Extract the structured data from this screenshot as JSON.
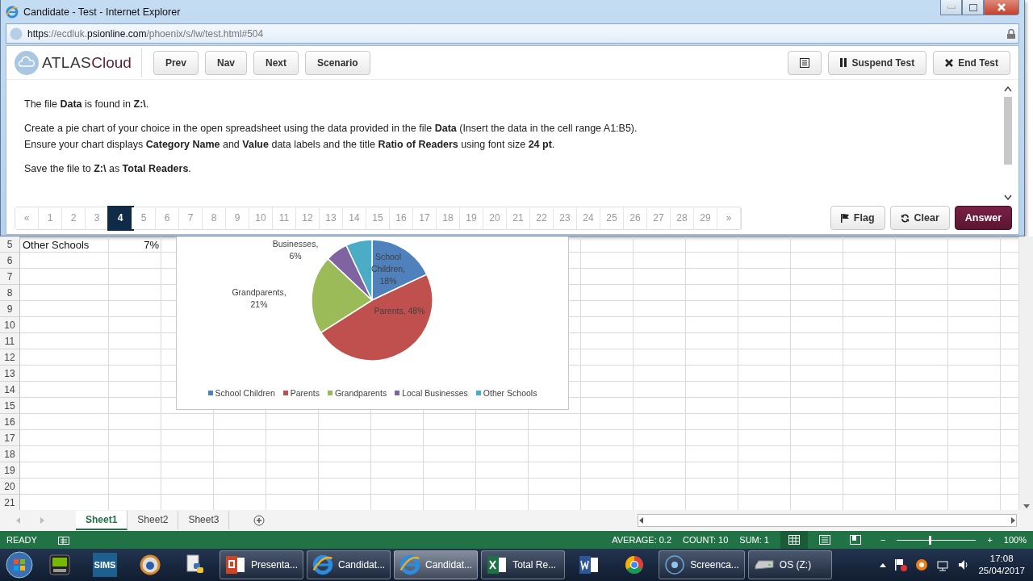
{
  "browser": {
    "title": "Candidate - Test - Internet Explorer",
    "address_parts": [
      {
        "text": "https",
        "strong": true
      },
      {
        "text": "://ecdluk.",
        "strong": false
      },
      {
        "text": "psionline.com",
        "strong": true
      },
      {
        "text": "/phoenix/s/lw/test.html#504",
        "strong": false
      }
    ]
  },
  "logo": {
    "part_1": "ATLAS",
    "part_2": "Cloud"
  },
  "toolbar_left": [
    "Prev",
    "Nav",
    "Next",
    "Scenario"
  ],
  "toolbar_right": [
    {
      "label": "Suspend Test",
      "kind": "pause"
    },
    {
      "label": "End Test",
      "kind": "end"
    }
  ],
  "question": [
    "The file **Data** is found in **Z:\\**.",
    "Create a pie chart of your choice in the open spreadsheet using the data provided in the file **Data** (Insert the data in the cell range A1:B5). Ensure your chart displays **Category Name** and **Value** data labels and the title **Ratio of Readers** using font size **24 pt**.",
    "Save the file to **Z:\\** as **Total Readers**."
  ],
  "pagination": {
    "prev": "«",
    "next": "»",
    "pages": [
      {
        "label": "1",
        "selected": false
      },
      {
        "label": "2",
        "selected": false
      },
      {
        "label": "3",
        "selected": false
      },
      {
        "label": "4",
        "selected": true
      },
      {
        "label": "5",
        "selected": false
      },
      {
        "label": "6",
        "selected": false
      },
      {
        "label": "7",
        "selected": false
      },
      {
        "label": "8",
        "selected": false
      },
      {
        "label": "9",
        "selected": false
      },
      {
        "label": "10",
        "selected": false
      },
      {
        "label": "11",
        "selected": false
      },
      {
        "label": "12",
        "selected": false
      },
      {
        "label": "13",
        "selected": false
      },
      {
        "label": "14",
        "selected": false
      },
      {
        "label": "15",
        "selected": false
      },
      {
        "label": "16",
        "selected": false
      },
      {
        "label": "17",
        "selected": false
      },
      {
        "label": "18",
        "selected": false
      },
      {
        "label": "19",
        "selected": false
      },
      {
        "label": "20",
        "selected": false
      },
      {
        "label": "21",
        "selected": false
      },
      {
        "label": "22",
        "selected": false
      },
      {
        "label": "23",
        "selected": false
      },
      {
        "label": "24",
        "selected": false
      },
      {
        "label": "25",
        "selected": false
      },
      {
        "label": "26",
        "selected": false
      },
      {
        "label": "27",
        "selected": false
      },
      {
        "label": "28",
        "selected": false
      },
      {
        "label": "29",
        "selected": false
      }
    ]
  },
  "actions": [
    {
      "label": "Flag",
      "kind": "flag"
    },
    {
      "label": "Clear",
      "kind": "clear"
    },
    {
      "label": "Answer",
      "kind": "primary"
    }
  ],
  "sheet": {
    "rows": [
      {
        "number": "5",
        "cells": [
          "Other Schools",
          "7%"
        ]
      },
      {
        "number": "6"
      },
      {
        "number": "7"
      },
      {
        "number": "8"
      },
      {
        "number": "9"
      },
      {
        "number": "10"
      },
      {
        "number": "11"
      },
      {
        "number": "12"
      },
      {
        "number": "13"
      },
      {
        "number": "14"
      },
      {
        "number": "15"
      },
      {
        "number": "16"
      },
      {
        "number": "17"
      },
      {
        "number": "18"
      },
      {
        "number": "19"
      },
      {
        "number": "20"
      },
      {
        "number": "21"
      }
    ],
    "chart_data": {
      "type": "pie",
      "categories": [
        "School Children",
        "Parents",
        "Grandparents",
        "Local Businesses",
        "Other Schools"
      ],
      "values": [
        18,
        48,
        21,
        6,
        7
      ],
      "colors": [
        "#4f81bd",
        "#c0504d",
        "#9bbb59",
        "#8064a2",
        "#4bacc6"
      ],
      "legend": "bottom",
      "value_labels": [
        "School Children, 18%",
        "Parents, 48%",
        "Grandparents, 21%",
        "Businesses, 6%",
        null
      ]
    }
  },
  "sheet_tabs": [
    {
      "label": "Sheet1",
      "selected": true
    },
    {
      "label": "Sheet2",
      "selected": false
    },
    {
      "label": "Sheet3",
      "selected": false
    }
  ],
  "status_bar": {
    "mode": "READY",
    "stats": [
      "AVERAGE: 0.2",
      "COUNT: 10",
      "SUM: 1"
    ],
    "views": [
      {
        "kind": "normal",
        "selected": true
      },
      {
        "kind": "layout",
        "selected": false
      },
      {
        "kind": "break",
        "selected": false
      }
    ],
    "zoom": {
      "minus": "−",
      "level": 0.4,
      "plus": "+",
      "reading": "100%"
    }
  },
  "taskbar": {
    "items": [
      {
        "kind": "nvidia"
      },
      {
        "kind": "sims",
        "label": "SIMS"
      },
      {
        "kind": "orb"
      },
      {
        "kind": "python"
      },
      {
        "kind": "powerpoint",
        "label": "Presenta...",
        "selected": false
      },
      {
        "kind": "ie",
        "label": "Candidat...",
        "selected": false
      },
      {
        "kind": "ie",
        "label": "Candidat...",
        "selected": true
      },
      {
        "kind": "excel",
        "label": "Total Re...",
        "selected": false
      },
      {
        "kind": "word"
      },
      {
        "kind": "chrome"
      },
      {
        "kind": "record",
        "label": "Screenca...",
        "selected": false
      },
      {
        "kind": "drive",
        "label": "OS (Z:)",
        "selected": false
      }
    ],
    "time": "17:08",
    "date": "25/04/2017"
  }
}
